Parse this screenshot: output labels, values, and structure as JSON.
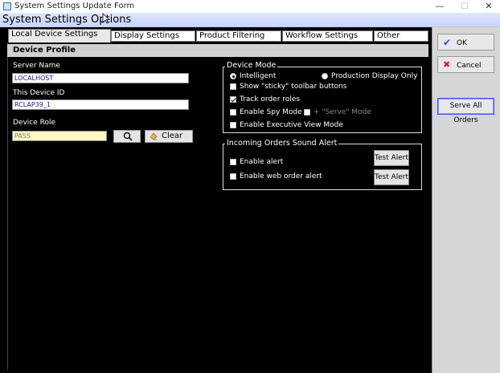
{
  "window": {
    "title": "System Settings Update Form",
    "controls": {
      "minimize": "—",
      "maximize": "☐",
      "close": "✕"
    }
  },
  "header": {
    "title": "System Settings Options"
  },
  "tabs": [
    {
      "label": "Local Device Settings",
      "active": true
    },
    {
      "label": "Display Settings",
      "active": false
    },
    {
      "label": "Product Filtering",
      "active": false
    },
    {
      "label": "Workflow Settings",
      "active": false
    },
    {
      "label": "Other",
      "active": false
    }
  ],
  "device_profile": {
    "title": "Device Profile",
    "server_name_label": "Server Name",
    "server_name_value": "LOCALHOST",
    "device_id_label": "This Device ID",
    "device_id_value": "RCLAP39_1",
    "device_role_label": "Device Role",
    "device_role_value": "PASS",
    "clear_label": "Clear"
  },
  "device_mode": {
    "title": "Device Mode",
    "intelligent": {
      "label": "Intelligent",
      "checked": true
    },
    "production_display_only": {
      "label": "Production Display Only",
      "checked": false
    },
    "sticky_toolbar": {
      "label": "Show \"sticky\" toolbar buttons",
      "checked": false
    },
    "track_order_roles": {
      "label": "Track order roles",
      "checked": true
    },
    "spy_mode": {
      "label": "Enable Spy Mode",
      "checked": false
    },
    "serve_mode": {
      "label": "+ \"Serve\" Mode",
      "checked": false
    },
    "executive_view": {
      "label": "Enable Executive View Mode",
      "checked": false
    }
  },
  "sound_alert": {
    "title": "Incoming Orders Sound Alert",
    "enable_alert": {
      "label": "Enable alert",
      "checked": false
    },
    "enable_web_order_alert": {
      "label": "Enable web order alert",
      "checked": false
    },
    "test_alert_label": "Test Alert"
  },
  "actions": {
    "ok_label": "OK",
    "cancel_label": "Cancel",
    "serve_all_orders_label": "Serve All Orders"
  },
  "icons": {
    "ok": "check-icon",
    "cancel": "x-icon",
    "search": "magnifier-icon",
    "clear": "eraser-icon"
  }
}
